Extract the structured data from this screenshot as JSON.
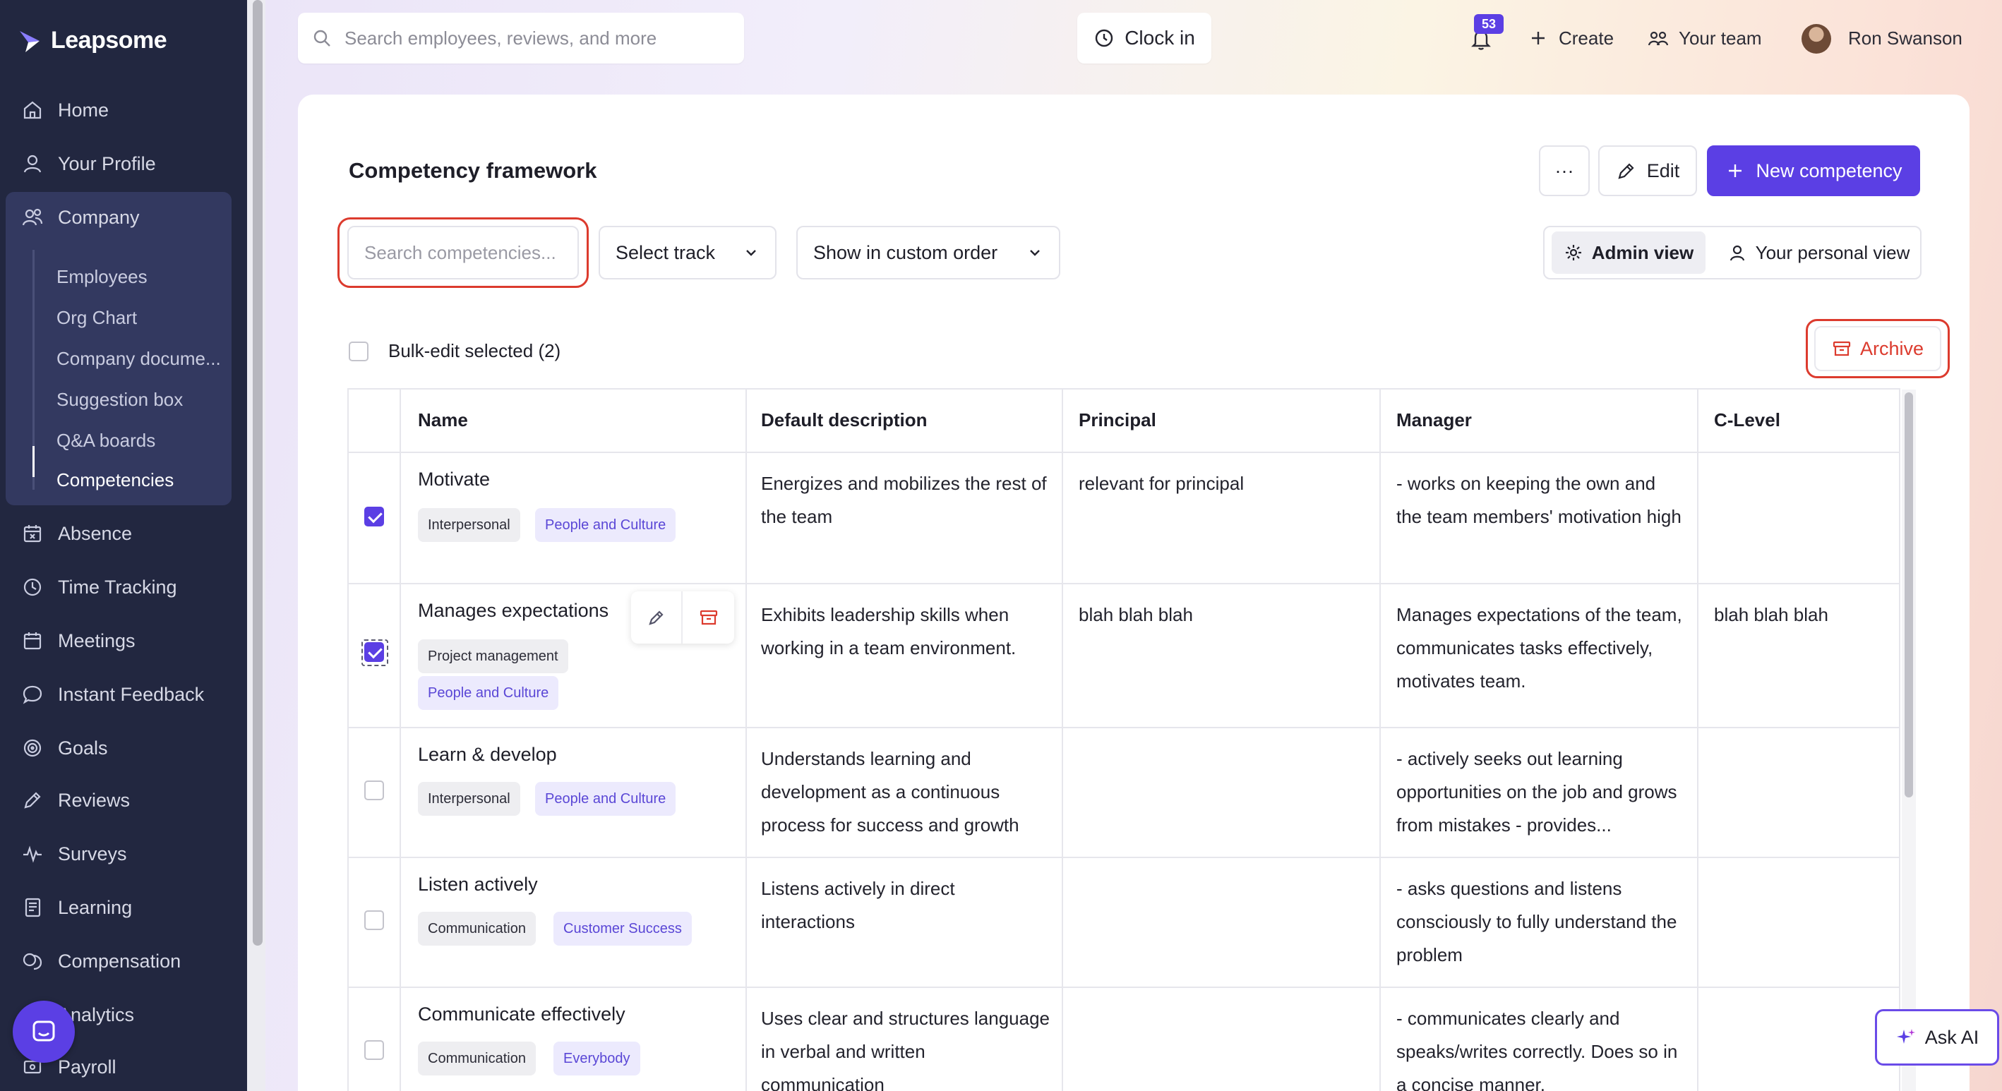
{
  "app": {
    "brand": "Leapsome",
    "accent": "#5b3fe4",
    "danger": "#dc3b2e"
  },
  "sidebar": {
    "items": [
      {
        "label": "Home",
        "icon": "home-icon"
      },
      {
        "label": "Your Profile",
        "icon": "user-icon"
      },
      {
        "label": "Company",
        "icon": "users-icon"
      },
      {
        "label": "Absence",
        "icon": "calendar-x-icon"
      },
      {
        "label": "Time Tracking",
        "icon": "clock-icon"
      },
      {
        "label": "Meetings",
        "icon": "calendar-icon"
      },
      {
        "label": "Instant Feedback",
        "icon": "message-icon"
      },
      {
        "label": "Goals",
        "icon": "target-icon"
      },
      {
        "label": "Reviews",
        "icon": "pen-icon"
      },
      {
        "label": "Surveys",
        "icon": "pulse-icon"
      },
      {
        "label": "Learning",
        "icon": "book-icon"
      },
      {
        "label": "Compensation",
        "icon": "coins-icon"
      },
      {
        "label": "Analytics",
        "icon": "chart-icon"
      },
      {
        "label": "Payroll",
        "icon": "payroll-icon"
      }
    ],
    "company_sub": [
      {
        "label": "Employees"
      },
      {
        "label": "Org Chart"
      },
      {
        "label": "Company docume..."
      },
      {
        "label": "Suggestion box"
      },
      {
        "label": "Q&A boards"
      },
      {
        "label": "Competencies",
        "active": true
      }
    ]
  },
  "topbar": {
    "search_placeholder": "Search employees, reviews, and more",
    "clock_in": "Clock in",
    "notifications": "53",
    "create": "Create",
    "your_team": "Your team",
    "user_name": "Ron Swanson"
  },
  "page": {
    "title": "Competency framework",
    "more": "···",
    "edit": "Edit",
    "new_competency": "New competency",
    "search_placeholder": "Search competencies...",
    "select_track": "Select track",
    "order": "Show in custom order",
    "admin_view": "Admin view",
    "personal_view": "Your personal view",
    "bulk_edit": "Bulk-edit selected (2)",
    "archive": "Archive"
  },
  "table": {
    "columns": [
      "Name",
      "Default description",
      "Principal",
      "Manager",
      "C-Level"
    ],
    "rows": [
      {
        "name": "Motivate",
        "checked": true,
        "tags": [
          "Interpersonal",
          "People and Culture"
        ],
        "description": "Energizes and mobilizes the rest of the team",
        "principal": "relevant for principal",
        "manager": "- works on keeping the own and the team members' motivation high",
        "clevel": ""
      },
      {
        "name": "Manages expectations",
        "checked": true,
        "tags": [
          "Project management",
          "People and Culture"
        ],
        "description": "Exhibits leadership skills when working in a team environment.",
        "principal": "blah blah blah",
        "manager": "Manages expectations of the team, communicates tasks effectively, motivates team.",
        "clevel": "blah blah blah"
      },
      {
        "name": "Learn & develop",
        "checked": false,
        "tags": [
          "Interpersonal",
          "People and Culture"
        ],
        "description": "Understands learning and development as a continuous process for success and growth",
        "principal": "",
        "manager": "- actively seeks out learning opportunities on the job and grows from mistakes - provides...",
        "clevel": ""
      },
      {
        "name": "Listen actively",
        "checked": false,
        "tags": [
          "Communication",
          "Customer Success"
        ],
        "description": "Listens actively in direct interactions",
        "principal": "",
        "manager": "- asks questions and listens consciously to fully understand the problem",
        "clevel": ""
      },
      {
        "name": "Communicate effectively",
        "checked": false,
        "tags": [
          "Communication",
          "Everybody"
        ],
        "description": "Uses clear and structures language in verbal and written communication",
        "principal": "",
        "manager": "- communicates clearly and speaks/writes correctly. Does so in a concise manner.",
        "clevel": ""
      }
    ]
  },
  "ask_ai": "Ask AI"
}
